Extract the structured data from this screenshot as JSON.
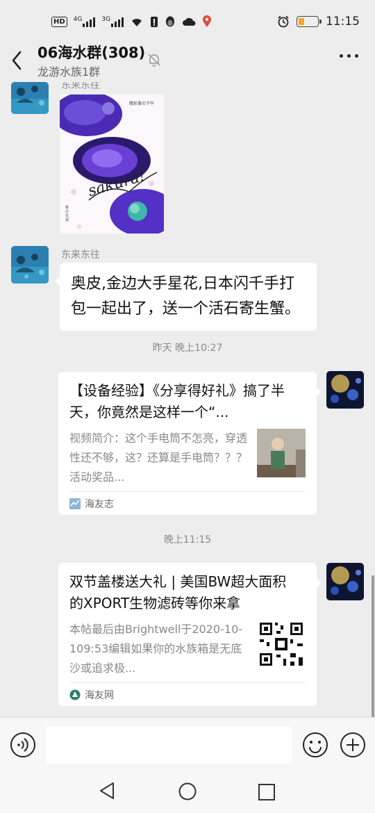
{
  "status_bar": {
    "time": "11:15",
    "network_labels": [
      "HD",
      "4G",
      "3G"
    ],
    "battery_color": "#f5a623"
  },
  "header": {
    "title": "06海水群(308)",
    "subtitle": "龙游水族1群",
    "icons": [
      "back-arrow-icon",
      "mute-bell-icon",
      "more-icon"
    ]
  },
  "messages": {
    "partial_sender": "东来东往",
    "image_message": {
      "text_vertical": "精彩事の下午",
      "script_text": "sakura!",
      "small_text": "春の花 桜"
    },
    "text_message": {
      "sender": "东来东往",
      "text": "奥皮,金边大手星花,日本闪千手打包一起出了，送一个活石寄生蟹。"
    },
    "time_1": "昨天 晚上10:27",
    "card_1": {
      "title": "【设备经验】《分享得好礼》搞了半天，你竟然是这样一个“...",
      "description": "视频简介：这个手电筒不怎亮，穿透性还不够，这？还算是手电筒？？？活动奖品...",
      "source": "海友志"
    },
    "time_2": "晚上11:15",
    "card_2": {
      "title": "双节盖楼送大礼 | 美国BW超大面积的XPORT生物滤砖等你来拿",
      "description": "本帖最后由Brightwell于2020-10-109:53编辑如果你的水族箱是无底沙或追求极...",
      "source": "海友网"
    }
  },
  "input_bar": {
    "placeholder": "",
    "icons": [
      "voice-icon",
      "emoji-icon",
      "plus-icon"
    ]
  },
  "nav_bar": {
    "icons": [
      "nav-back-icon",
      "nav-home-icon",
      "nav-recent-icon"
    ]
  }
}
